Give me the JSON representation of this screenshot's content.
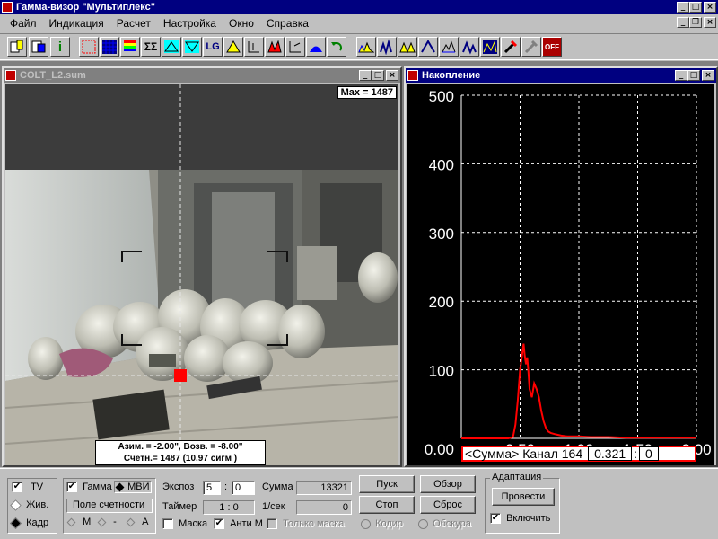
{
  "app": {
    "title": "Гамма-визор \"Мультиплекс\""
  },
  "menu": {
    "items": [
      "Файл",
      "Индикация",
      "Расчет",
      "Настройка",
      "Окно",
      "Справка"
    ],
    "mnemonic": [
      "Ф",
      "И",
      "Р",
      "Н",
      "О",
      "С"
    ]
  },
  "toolbar": {
    "lg_label": "LG",
    "info_label": "i",
    "off_label": "OFF"
  },
  "image_window": {
    "title": "COLT_L2.sum",
    "max_label": "Max = 1487",
    "coords": "Азим. = -2.00\", Возв. = -8.00\"",
    "count": "Счетн.= 1487 (10.97 сигм )"
  },
  "chart_window": {
    "title": "Накопление"
  },
  "chart_data": {
    "type": "line",
    "y_ticks": [
      "500",
      "400",
      "300",
      "200",
      "100"
    ],
    "x_ticks": [
      "0.00",
      "0.50",
      "1.00",
      "1.50",
      "2.00"
    ],
    "xlim": [
      0.0,
      2.0
    ],
    "ylim": [
      0,
      500
    ],
    "grid": true,
    "series": [
      {
        "color": "#ff0000",
        "x": [
          0.0,
          0.4,
          0.44,
          0.46,
          0.48,
          0.5,
          0.52,
          0.53,
          0.54,
          0.55,
          0.56,
          0.57,
          0.58,
          0.6,
          0.62,
          0.64,
          0.66,
          0.68,
          0.7,
          0.72,
          0.74,
          0.76,
          0.8,
          0.85,
          0.9,
          1.0,
          1.1,
          1.25,
          1.4,
          1.6,
          1.8,
          2.0
        ],
        "y": [
          0,
          0,
          2,
          20,
          55,
          100,
          125,
          138,
          120,
          108,
          118,
          98,
          72,
          60,
          80,
          72,
          60,
          40,
          25,
          15,
          10,
          8,
          6,
          4,
          3,
          3,
          2,
          2,
          1,
          1,
          1,
          1
        ]
      }
    ],
    "status": {
      "label": "<Сумма> Канал 164",
      "value": "0.321",
      "extra": "0"
    }
  },
  "controls": {
    "tv": "TV",
    "live": "Жив.",
    "frame": "Кадр",
    "gamma": "Гамма",
    "mvi": "МВИ",
    "count_field": "Поле  счетности",
    "m_label": "М",
    "dash_label": "-",
    "a_label": "А",
    "expos_label": "Экспоз",
    "expos_min": "5",
    "expos_sec": "0",
    "timer_label": "Таймер",
    "timer_min": "1",
    "timer_sec": "0",
    "sum_label": "Сумма",
    "sum_value": "13321",
    "rate_label": "1/сек",
    "rate_value": "0",
    "mask_label": "Маска",
    "antimask_label": "Анти М",
    "only_mask_label": "Только маска",
    "start_btn": "Пуск",
    "stop_btn": "Стоп",
    "review_btn": "Обзор",
    "reset_btn": "Сброс",
    "code_label": "Кодир",
    "obscura_label": "Обскура",
    "adapt_label": "Адаптация",
    "run_btn": "Провести",
    "enable_label": "Включить"
  }
}
